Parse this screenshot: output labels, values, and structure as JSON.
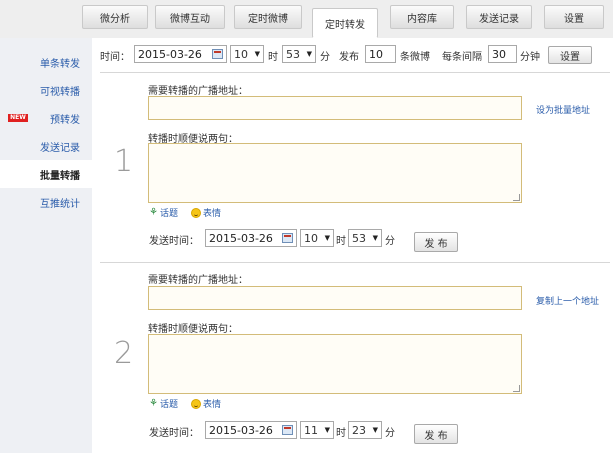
{
  "tabs": [
    {
      "label": "微分析"
    },
    {
      "label": "微博互动"
    },
    {
      "label": "定时微博"
    },
    {
      "label": "定时转发"
    },
    {
      "label": "内容库"
    },
    {
      "label": "发送记录"
    },
    {
      "label": "设置"
    }
  ],
  "active_tab": "定时转发",
  "sidebar": {
    "items": [
      {
        "label": "单条转发"
      },
      {
        "label": "可视转播"
      },
      {
        "label": "预转发",
        "badge": "NEW"
      },
      {
        "label": "发送记录"
      },
      {
        "label": "批量转播"
      },
      {
        "label": "互推统计"
      }
    ],
    "active": "批量转播"
  },
  "settings_row": {
    "time_label": "时间：",
    "date": "2015-03-26",
    "hour": "10",
    "hour_unit": "时",
    "minute": "53",
    "minute_unit": "分",
    "publish_label": "发布",
    "count": "10",
    "count_unit": "条微博",
    "interval_label": "每条间隔",
    "interval": "30",
    "interval_unit": "分钟",
    "set_button": "设置"
  },
  "entries": [
    {
      "number": "1",
      "url_label": "需要转播的广播地址：",
      "url_value": "",
      "side_link": "设为批量地址",
      "comment_label": "转播时顺便说两句：",
      "comment_value": "",
      "topic_label": "话题",
      "emoji_label": "表情",
      "send_time_label": "发送时间：",
      "date": "2015-03-26",
      "hour": "10",
      "hour_unit": "时",
      "minute": "53",
      "minute_unit": "分",
      "publish_button": "发 布"
    },
    {
      "number": "2",
      "url_label": "需要转播的广播地址：",
      "url_value": "",
      "side_link": "复制上一个地址",
      "comment_label": "转播时顺便说两句：",
      "comment_value": "",
      "topic_label": "话题",
      "emoji_label": "表情",
      "send_time_label": "发送时间：",
      "date": "2015-03-26",
      "hour": "11",
      "hour_unit": "时",
      "minute": "23",
      "minute_unit": "分",
      "publish_button": "发 布"
    }
  ]
}
